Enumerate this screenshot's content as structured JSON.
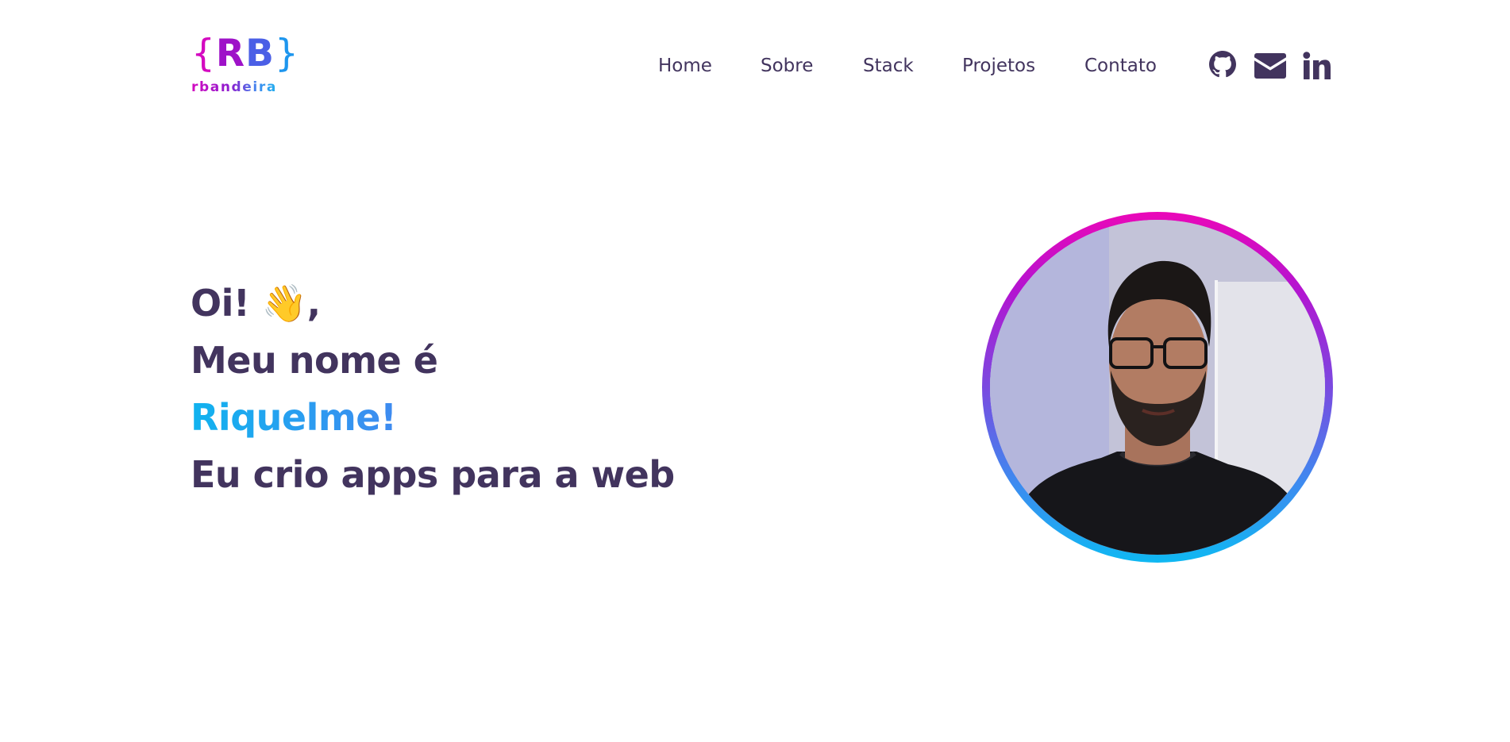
{
  "logo": {
    "brace_left": "{",
    "initial_r": "R",
    "initial_b": "B",
    "brace_right": "}",
    "name": "rbandeira",
    "colors": {
      "magenta": "#d40ac0",
      "purple": "#9e12c8",
      "blue": "#4b5fe6",
      "cyan": "#1e96ee"
    }
  },
  "nav": {
    "items": [
      {
        "label": "Home"
      },
      {
        "label": "Sobre"
      },
      {
        "label": "Stack"
      },
      {
        "label": "Projetos"
      },
      {
        "label": "Contato"
      }
    ],
    "social": [
      {
        "icon": "github-icon"
      },
      {
        "icon": "mail-icon"
      },
      {
        "icon": "linkedin-icon"
      }
    ]
  },
  "hero": {
    "greeting": "Oi! 👋,",
    "intro": "Meu nome é",
    "name": "Riquelme!",
    "tagline": "Eu crio apps para a web"
  },
  "avatar": {
    "icon": "profile-photo",
    "ring_gradient": [
      "#ea08b8",
      "#b414d0",
      "#7a4ae0",
      "#3c8cf0",
      "#0fb8f2"
    ]
  },
  "colors": {
    "text": "#42345e",
    "background": "#ffffff"
  }
}
